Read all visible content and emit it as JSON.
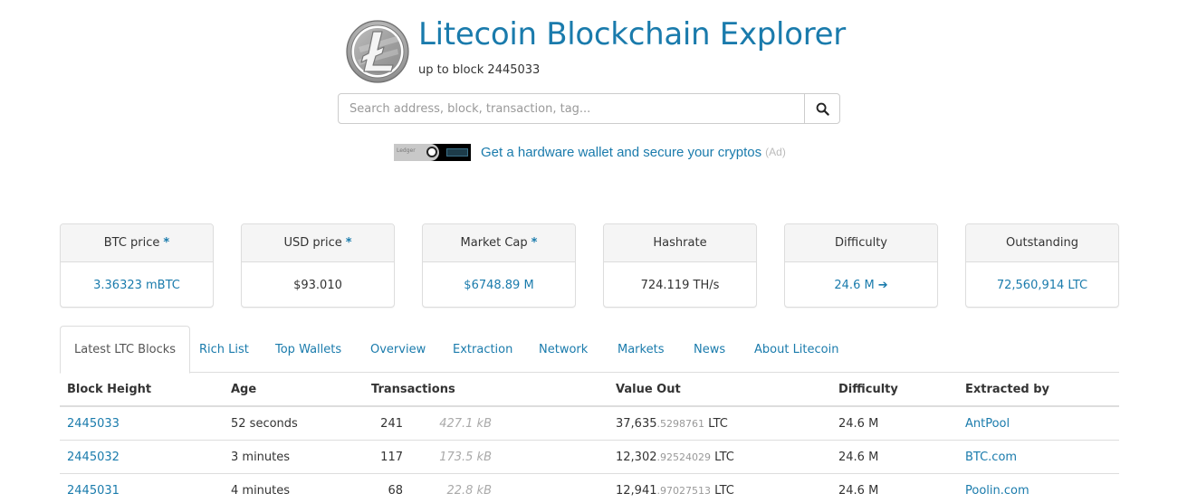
{
  "header": {
    "title": "Litecoin Blockchain Explorer",
    "subtitle": "up to block 2445033"
  },
  "search": {
    "placeholder": "Search address, block, transaction, tag...",
    "value": "",
    "button_icon": "search-icon"
  },
  "ad": {
    "image_label": "Ledger",
    "link_text": "Get a hardware wallet and secure your cryptos",
    "tag": "(Ad)"
  },
  "stats": [
    {
      "label": "BTC price",
      "starred": true,
      "value": "3.36323 mBTC",
      "is_link": true
    },
    {
      "label": "USD price",
      "starred": true,
      "value": "$93.010",
      "is_link": false
    },
    {
      "label": "Market Cap",
      "starred": true,
      "value": "$6748.89 M",
      "is_link": true
    },
    {
      "label": "Hashrate",
      "starred": false,
      "value": "724.119 TH/s",
      "is_link": false
    },
    {
      "label": "Difficulty",
      "starred": false,
      "value": "24.6 M",
      "is_link": true,
      "icon": "arrow-right-icon"
    },
    {
      "label": "Outstanding",
      "starred": false,
      "value": "72,560,914 LTC",
      "is_link": true
    }
  ],
  "star_glyph": "*",
  "arrow_glyph": "➔",
  "tabs": [
    {
      "label": "Latest LTC Blocks",
      "active": true
    },
    {
      "label": "Rich List",
      "active": false
    },
    {
      "label": "Top Wallets",
      "active": false
    },
    {
      "label": "Overview",
      "active": false
    },
    {
      "label": "Extraction",
      "active": false
    },
    {
      "label": "Network",
      "active": false
    },
    {
      "label": "Markets",
      "active": false
    },
    {
      "label": "News",
      "active": false
    },
    {
      "label": "About Litecoin",
      "active": false
    }
  ],
  "table": {
    "columns": [
      "Block Height",
      "Age",
      "Transactions",
      "Value Out",
      "Difficulty",
      "Extracted by"
    ],
    "rows": [
      {
        "block": "2445033",
        "age": "52 seconds",
        "tx_count": "241",
        "size": "427.1 kB",
        "value_int": "37,635",
        "value_dec": ".5298761",
        "value_unit": " LTC",
        "difficulty": "24.6 M",
        "miner": "AntPool"
      },
      {
        "block": "2445032",
        "age": "3 minutes",
        "tx_count": "117",
        "size": "173.5 kB",
        "value_int": "12,302",
        "value_dec": ".92524029",
        "value_unit": " LTC",
        "difficulty": "24.6 M",
        "miner": "BTC.com"
      },
      {
        "block": "2445031",
        "age": "4 minutes",
        "tx_count": "68",
        "size": "22.8 kB",
        "value_int": "12,941",
        "value_dec": ".97027513",
        "value_unit": " LTC",
        "difficulty": "24.6 M",
        "miner": "Poolin.com"
      }
    ]
  },
  "colors": {
    "accent": "#1a7bac",
    "text": "#333333",
    "muted": "#999999",
    "border": "#dddddd",
    "panel_head": "#f5f5f5"
  }
}
